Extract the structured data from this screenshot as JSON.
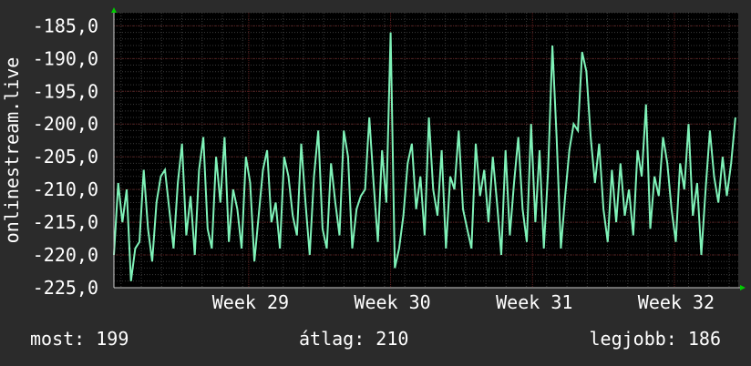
{
  "colors": {
    "background": "#2b2b2b",
    "plot_background": "#000000",
    "grid_major": "#5a1a1a",
    "grid_minor": "#3a3a3a",
    "line": "#7ff2b8",
    "axis_arrow": "#00cc00"
  },
  "stats": {
    "current": "most: 199",
    "average": "átlag: 210",
    "best": "legjobb: 186"
  },
  "chart_data": {
    "type": "line",
    "ylabel": "onlinestream.live",
    "ylim": [
      -225,
      -183
    ],
    "y_ticks": [
      -185,
      -190,
      -195,
      -200,
      -205,
      -210,
      -215,
      -220,
      -225
    ],
    "y_tick_labels": [
      "-185,0",
      "-190,0",
      "-195,0",
      "-200,0",
      "-205,0",
      "-210,0",
      "-215,0",
      "-220,0",
      "-225,0"
    ],
    "xlim": [
      0,
      4.4
    ],
    "x_ticks": [
      0.95,
      1.95,
      2.95,
      3.95
    ],
    "x_tick_labels": [
      "Week 29",
      "Week 30",
      "Week 31",
      "Week 32"
    ],
    "grid": true,
    "series": [
      {
        "x": [
          0,
          0.03,
          0.06,
          0.09,
          0.12,
          0.15,
          0.18,
          0.21,
          0.24,
          0.27,
          0.3,
          0.33,
          0.36,
          0.39,
          0.42,
          0.45,
          0.48,
          0.51,
          0.54,
          0.57,
          0.6,
          0.63,
          0.66,
          0.69,
          0.72,
          0.75,
          0.78,
          0.81,
          0.84,
          0.87,
          0.9,
          0.93,
          0.96,
          0.99,
          1.02,
          1.05,
          1.08,
          1.11,
          1.14,
          1.17,
          1.2,
          1.23,
          1.26,
          1.29,
          1.32,
          1.35,
          1.38,
          1.41,
          1.44,
          1.47,
          1.5,
          1.53,
          1.56,
          1.59,
          1.62,
          1.65,
          1.68,
          1.71,
          1.74,
          1.77,
          1.8,
          1.83,
          1.86,
          1.89,
          1.92,
          1.95,
          1.98,
          2.01,
          2.04,
          2.07,
          2.1,
          2.13,
          2.16,
          2.19,
          2.22,
          2.25,
          2.28,
          2.31,
          2.34,
          2.37,
          2.4,
          2.43,
          2.46,
          2.49,
          2.52,
          2.55,
          2.58,
          2.61,
          2.64,
          2.67,
          2.7,
          2.73,
          2.76,
          2.79,
          2.82,
          2.85,
          2.88,
          2.91,
          2.94,
          2.97,
          3.0,
          3.03,
          3.06,
          3.09,
          3.12,
          3.15,
          3.18,
          3.21,
          3.24,
          3.27,
          3.3,
          3.33,
          3.36,
          3.39,
          3.42,
          3.45,
          3.48,
          3.51,
          3.54,
          3.57,
          3.6,
          3.63,
          3.66,
          3.69,
          3.72,
          3.75,
          3.78,
          3.81,
          3.84,
          3.87,
          3.9,
          3.93,
          3.96,
          3.99,
          4.02,
          4.05,
          4.08,
          4.11,
          4.14,
          4.17,
          4.2,
          4.23,
          4.26,
          4.29,
          4.32,
          4.35,
          4.38
        ],
        "values": [
          -220,
          -209,
          -215,
          -210,
          -224,
          -219,
          -218,
          -207,
          -216,
          -221,
          -212,
          -208,
          -207,
          -213,
          -219,
          -209,
          -203,
          -217,
          -211,
          -220,
          -207,
          -202,
          -216,
          -219,
          -205,
          -212,
          -202,
          -218,
          -210,
          -213,
          -219,
          -205,
          -209,
          -221,
          -214,
          -207,
          -204,
          -215,
          -212,
          -219,
          -205,
          -208,
          -214,
          -217,
          -203,
          -212,
          -220,
          -208,
          -201,
          -216,
          -219,
          -206,
          -212,
          -217,
          -201,
          -205,
          -219,
          -213,
          -211,
          -210,
          -199,
          -209,
          -218,
          -204,
          -212,
          -186,
          -222,
          -219,
          -214,
          -206,
          -203,
          -213,
          -208,
          -217,
          -199,
          -210,
          -214,
          -204,
          -219,
          -208,
          -210,
          -201,
          -213,
          -216,
          -219,
          -203,
          -211,
          -207,
          -215,
          -205,
          -212,
          -220,
          -204,
          -217,
          -209,
          -202,
          -213,
          -218,
          -200,
          -215,
          -204,
          -219,
          -207,
          -188,
          -202,
          -219,
          -211,
          -204,
          -200,
          -201,
          -189,
          -192,
          -202,
          -209,
          -203,
          -213,
          -218,
          -207,
          -215,
          -206,
          -214,
          -210,
          -217,
          -204,
          -208,
          -197,
          -216,
          -208,
          -211,
          -202,
          -206,
          -213,
          -218,
          -206,
          -210,
          -200,
          -214,
          -209,
          -220,
          -210,
          -201,
          -208,
          -212,
          -205,
          -211,
          -206,
          -199
        ]
      }
    ]
  }
}
